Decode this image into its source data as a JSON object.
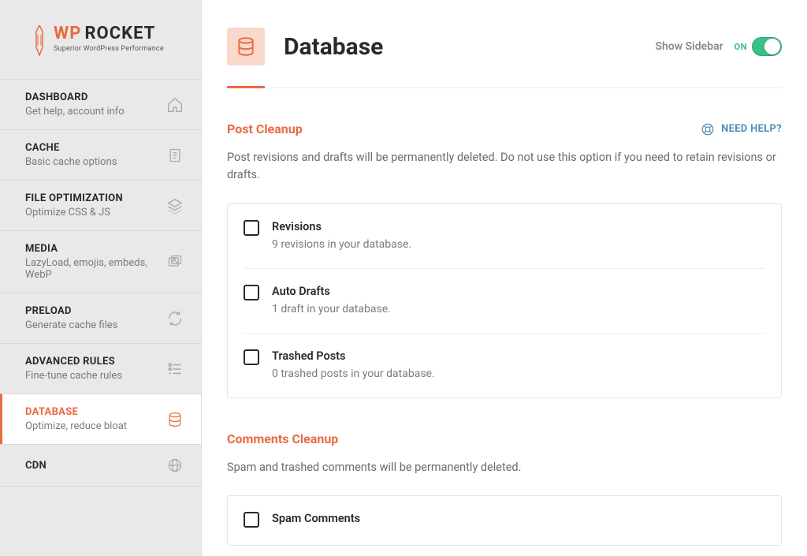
{
  "brand": {
    "wp": "WP",
    "rocket": "ROCKET",
    "tagline": "Superior WordPress Performance"
  },
  "sidebar": {
    "items": [
      {
        "title": "DASHBOARD",
        "sub": "Get help, account info",
        "icon": "home"
      },
      {
        "title": "CACHE",
        "sub": "Basic cache options",
        "icon": "document"
      },
      {
        "title": "FILE OPTIMIZATION",
        "sub": "Optimize CSS & JS",
        "icon": "layers"
      },
      {
        "title": "MEDIA",
        "sub": "LazyLoad, emojis, embeds, WebP",
        "icon": "images"
      },
      {
        "title": "PRELOAD",
        "sub": "Generate cache files",
        "icon": "refresh"
      },
      {
        "title": "ADVANCED RULES",
        "sub": "Fine-tune cache rules",
        "icon": "list"
      },
      {
        "title": "DATABASE",
        "sub": "Optimize, reduce bloat",
        "icon": "database",
        "active": true
      },
      {
        "title": "CDN",
        "sub": "",
        "icon": "globe"
      }
    ]
  },
  "header": {
    "title": "Database",
    "showSidebar": "Show Sidebar",
    "toggleState": "ON"
  },
  "help": {
    "label": "NEED HELP?"
  },
  "sections": [
    {
      "title": "Post Cleanup",
      "desc": "Post revisions and drafts will be permanently deleted. Do not use this option if you need to retain revisions or drafts.",
      "options": [
        {
          "label": "Revisions",
          "sub": "9 revisions in your database."
        },
        {
          "label": "Auto Drafts",
          "sub": "1 draft in your database."
        },
        {
          "label": "Trashed Posts",
          "sub": "0 trashed posts in your database."
        }
      ]
    },
    {
      "title": "Comments Cleanup",
      "desc": "Spam and trashed comments will be permanently deleted.",
      "options": [
        {
          "label": "Spam Comments",
          "sub": ""
        }
      ]
    }
  ]
}
